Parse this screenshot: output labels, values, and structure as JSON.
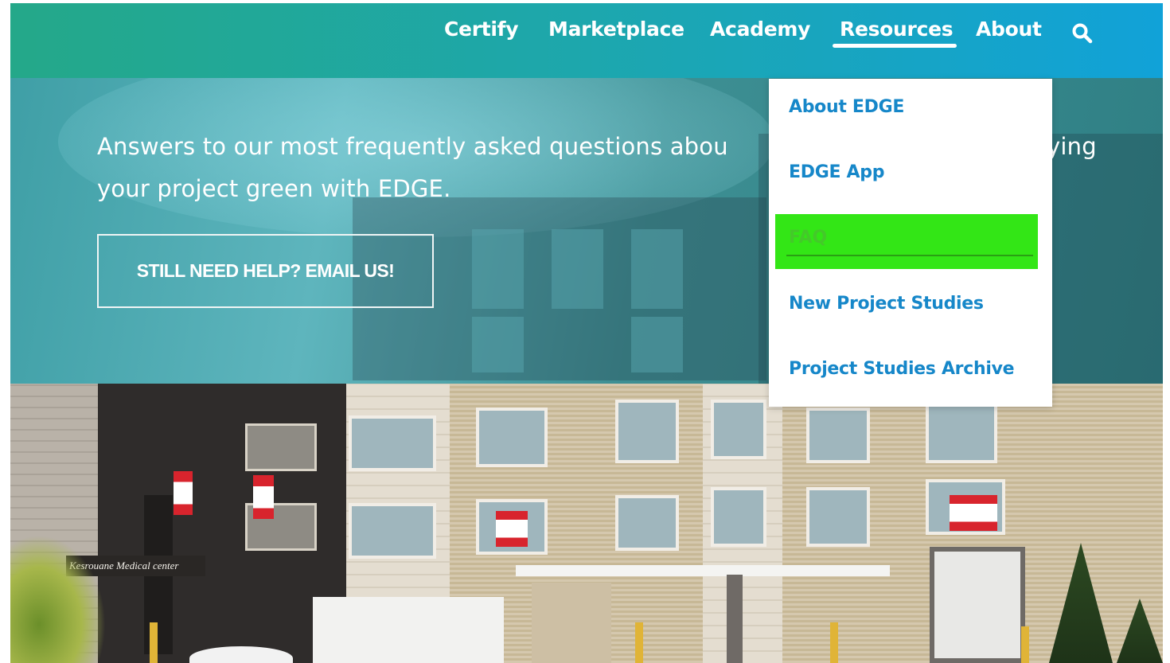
{
  "nav": {
    "items": [
      "Certify",
      "Marketplace",
      "Academy",
      "Resources",
      "About"
    ],
    "active": "Resources",
    "search_icon": "search-icon",
    "gradient": [
      "#24a889",
      "#11a2d8"
    ]
  },
  "hero": {
    "text_line1": "Answers to our most frequently asked questions abou",
    "text_line1_tail": "ying",
    "text_line2": "your project green with EDGE.",
    "cta_label": "STILL NEED HELP? EMAIL US!"
  },
  "dropdown": {
    "items": [
      "About EDGE",
      "EDGE App",
      "FAQ",
      "New Project Studies",
      "Project Studies Archive"
    ],
    "highlighted": "FAQ",
    "item_color": "#1687c9",
    "highlight_color": "#33e616"
  },
  "building": {
    "sign_text": "Kesrouane  Medical center"
  }
}
